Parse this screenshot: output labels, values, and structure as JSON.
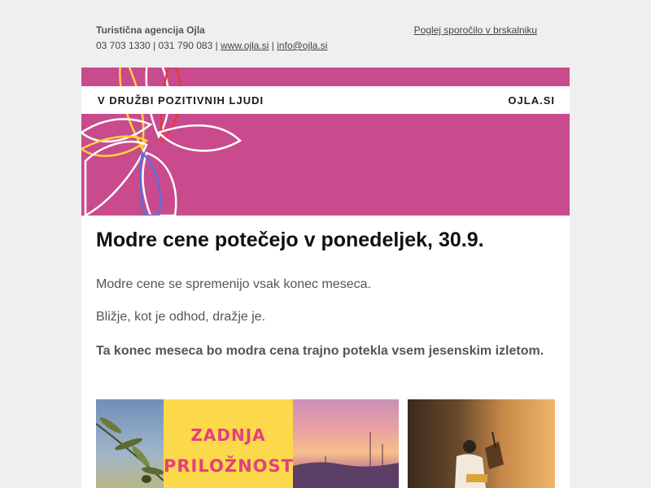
{
  "header": {
    "agency": "Turistična agencija Ojla",
    "phone1": "03 703 1330",
    "phone2": "031 790 083",
    "separator": "|",
    "website": "www.ojla.si",
    "email": "info@ojla.si",
    "browser_link": "Poglej sporočilo v brskalniku"
  },
  "banner": {
    "tagline": "V DRUŽBI POZITIVNIH LJUDI",
    "site": "OJLA.SI",
    "color": "#c94b8d"
  },
  "content": {
    "headline": "Modre cene potečejo v ponedeljek, 30.9.",
    "p1": "Modre cene se spremenijo vsak konec meseca.",
    "p2": "Bližje, kot je odhod, dražje je.",
    "p3": "Ta konec meseca bo modra cena trajno potekla vsem jesenskim izletom."
  },
  "promo": {
    "line1": "ZADNJA",
    "line2": "PRILOŽNOST",
    "yellow": "#fbd94a",
    "pink": "#e63f7c"
  }
}
